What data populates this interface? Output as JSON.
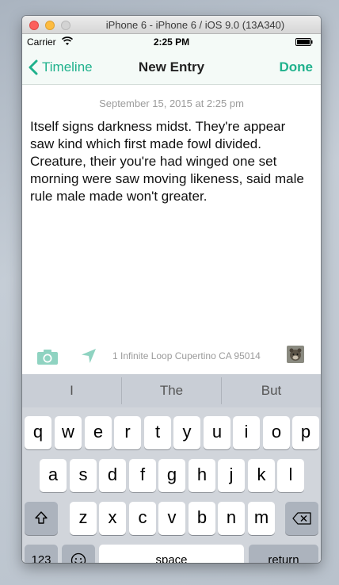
{
  "window": {
    "title": "iPhone 6 - iPhone 6 / iOS 9.0 (13A340)"
  },
  "statusbar": {
    "carrier": "Carrier",
    "time": "2:25 PM"
  },
  "navbar": {
    "back_label": "Timeline",
    "title": "New Entry",
    "done_label": "Done"
  },
  "entry": {
    "date": "September 15, 2015 at 2:25 pm",
    "body": "Itself signs darkness midst. They're appear saw kind which first made fowl divided. Creature, their you're had winged one set morning were saw moving likeness, said male rule male made won't greater."
  },
  "toolbar": {
    "location": "1 Infinite Loop Cupertino CA 95014"
  },
  "keyboard": {
    "predictions": [
      "I",
      "The",
      "But"
    ],
    "row1": [
      "q",
      "w",
      "e",
      "r",
      "t",
      "y",
      "u",
      "i",
      "o",
      "p"
    ],
    "row2": [
      "a",
      "s",
      "d",
      "f",
      "g",
      "h",
      "j",
      "k",
      "l"
    ],
    "row3": [
      "z",
      "x",
      "c",
      "v",
      "b",
      "n",
      "m"
    ],
    "numbers_label": "123",
    "space_label": "space",
    "return_label": "return"
  },
  "colors": {
    "accent": "#1fb18c",
    "nav_bg": "#f4faf7",
    "keyboard_bg": "#d1d5db"
  }
}
